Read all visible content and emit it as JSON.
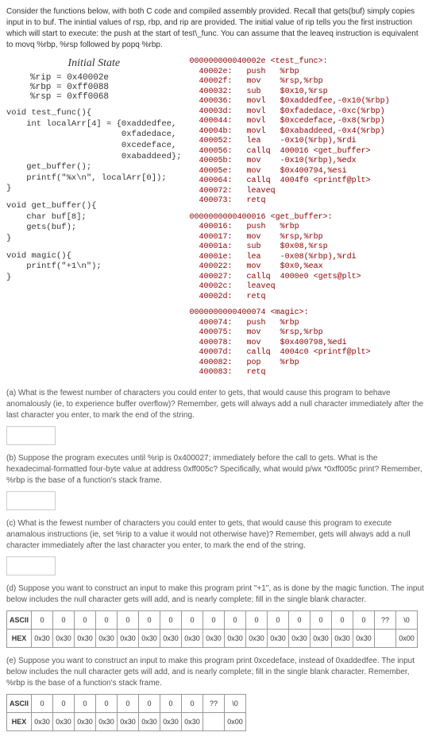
{
  "intro": "Consider the functions below, with both C code and compiled assembly provided. Recall that gets(buf) simply copies input in to buf. The inintial values of rsp, rbp, and rip are provided. The initial value of rip tells you the first instruction which will start to execute: the push at the start of test\\_func. You can assume that the leaveq instruction is equivalent to movq %rbp, %rsp followed by popq %rbp.",
  "panel_title": "Initial State",
  "regs": {
    "rip": "%rip = 0x40002e",
    "rbp": "%rbp = 0xff0088",
    "rsp": "%rsp = 0xff0068"
  },
  "c_test_func": "void test_func(){\n    int localArr[4] = {0xaddedfee,\n                       0xfadedace,\n                       0xcedeface,\n                       0xabaddeed};\n    get_buffer();\n    printf(\"%x\\n\", localArr[0]);\n}",
  "c_get_buffer": "void get_buffer(){\n    char buf[8];\n    gets(buf);\n}",
  "c_magic": "void magic(){\n    printf(\"+1\\n\");\n}",
  "asm_test_func": "000000000040002e <test_func>:\n  40002e:   push   %rbp\n  40002f:   mov    %rsp,%rbp\n  400032:   sub    $0x10,%rsp\n  400036:   movl   $0xaddedfee,-0x10(%rbp)\n  40003d:   movl   $0xfadedace,-0xc(%rbp)\n  400044:   movl   $0xcedeface,-0x8(%rbp)\n  40004b:   movl   $0xabaddeed,-0x4(%rbp)\n  400052:   lea    -0x10(%rbp),%rdi\n  400056:   callq  400016 <get_buffer>\n  40005b:   mov    -0x10(%rbp),%edx\n  40005e:   mov    $0x400794,%esi\n  400064:   callq  4004f0 <printf@plt>\n  400072:   leaveq\n  400073:   retq",
  "asm_get_buffer": "0000000000400016 <get_buffer>:\n  400016:   push   %rbp\n  400017:   mov    %rsp,%rbp\n  40001a:   sub    $0x08,%rsp\n  40001e:   lea    -0x08(%rbp),%rdi\n  400022:   mov    $0x0,%eax\n  400027:   callq  4000e0 <gets@plt>\n  40002c:   leaveq\n  40002d:   retq",
  "asm_magic": "0000000000400074 <magic>:\n  400074:   push   %rbp\n  400075:   mov    %rsp,%rbp\n  400078:   mov    $0x400798,%edi\n  40007d:   callq  4004c0 <printf@plt>\n  400082:   pop    %rbp\n  400083:   retq",
  "q_a": "(a) What is the fewest number of characters you could enter to gets, that would cause this program to behave anomalously (ie, to experience buffer overflow)? Remember, gets will always add a null character immediately after the last character you enter, to mark the end of the string.",
  "q_b": "(b) Suppose the program executes until %rip is 0x400027; immediately before the call to gets. What is the hexadecimal-formatted four-byte value at address 0xff005c? Specifically, what would p/wx *0xff005c print? Remember, %rbp is the base of a function's stack frame.",
  "q_c": "(c) What is the fewest number of characters you could enter to gets, that would cause this program to execute anamalous instructions (ie, set %rip to a value it would not otherwise have)? Remember, gets will always add a null character immediately after the last character you enter, to mark the end of the string.",
  "q_d": "(d) Suppose you want to construct an input to make this program print \"+1\", as is done by the magic function. The input below includes the null character gets will add, and is nearly complete; fill in the single blank character.",
  "q_e": "(e) Suppose you want to construct an input to make this program print 0xcedeface, instead of 0xaddedfee. The input below includes the null character gets will add, and is nearly complete; fill in the single blank character. Remember, %rbp is the base of a function's stack frame.",
  "table_labels": {
    "ascii": "ASCII",
    "hex": "HEX",
    "zero": "0",
    "hex30": "0x30",
    "qq": "??",
    "bslash0": "\\0",
    "hex00": "0x00"
  }
}
